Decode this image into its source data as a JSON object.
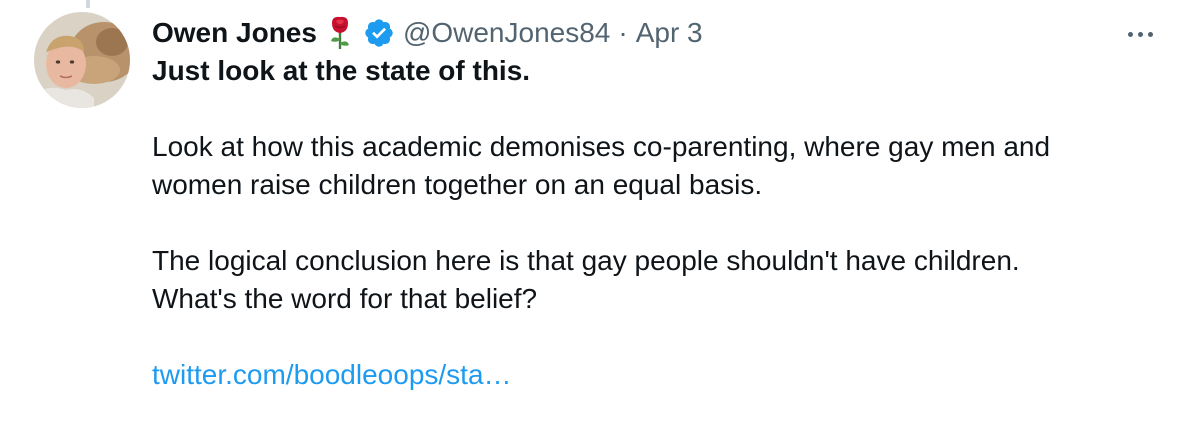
{
  "tweet": {
    "display_name": "Owen Jones",
    "handle": "@OwenJones84",
    "separator": "·",
    "timestamp": "Apr 3",
    "lines": {
      "headline": "Just look at the state of this.",
      "para1_line1": "Look at how this academic demonises co-parenting, where gay men and",
      "para1_line2": "women raise children together on an equal basis.",
      "para2_line1": "The logical conclusion here is that gay people shouldn't have children.",
      "para2_line2": "What's the word for that belief?"
    },
    "link_text": "twitter.com/boodleoops/sta…",
    "icons": {
      "rose": "rose-icon",
      "verified": "verified-badge-icon",
      "more": "more-options-icon"
    },
    "colors": {
      "text": "#0f1419",
      "secondary": "#536471",
      "link": "#1d9bf0",
      "verified": "#1d9bf0",
      "rose": "#c8102e"
    }
  }
}
